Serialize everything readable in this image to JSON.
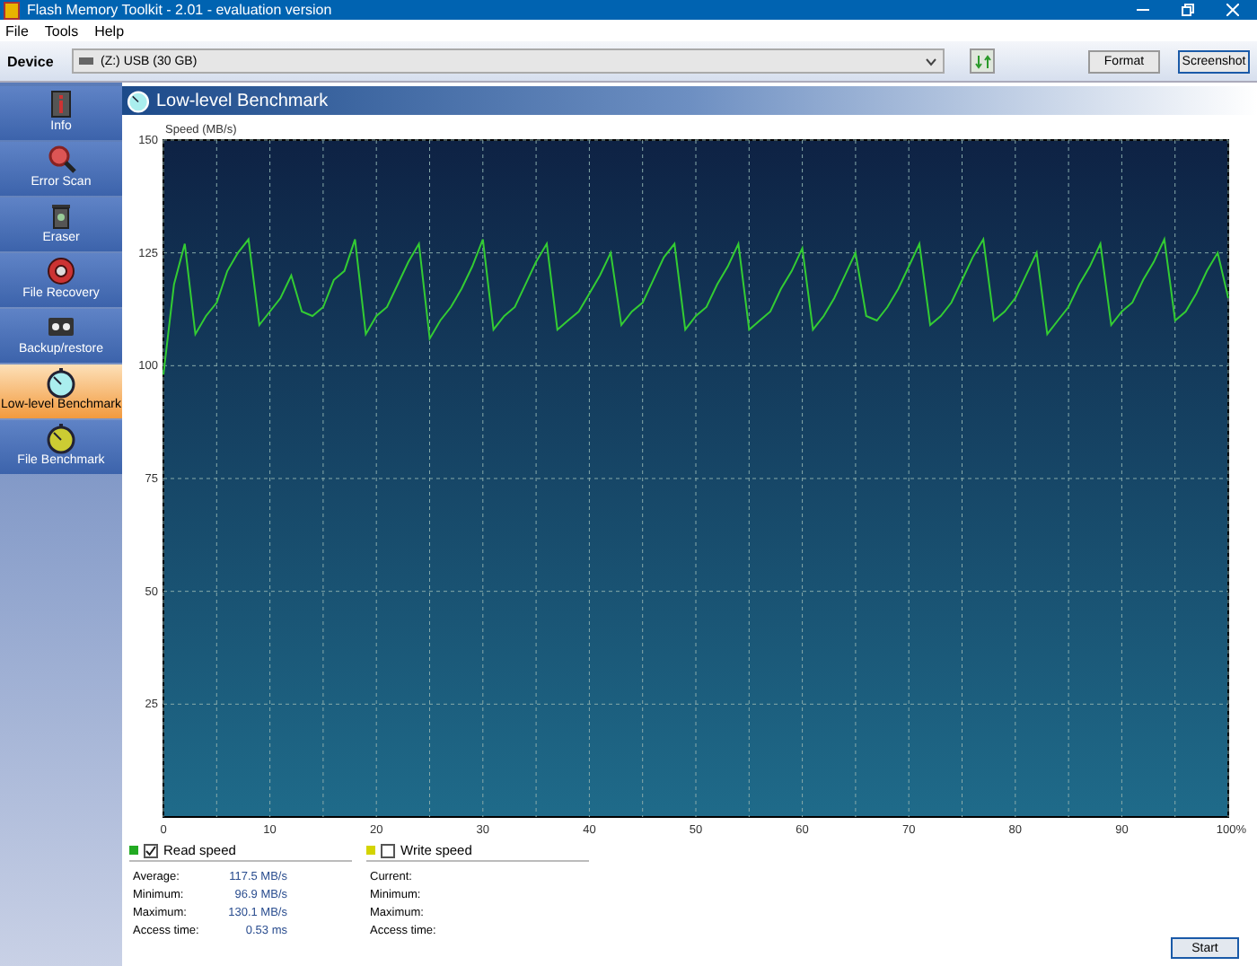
{
  "window": {
    "title": "Flash Memory Toolkit - 2.01 - evaluation version"
  },
  "menu": [
    "File",
    "Tools",
    "Help"
  ],
  "toolbar": {
    "device_label": "Device",
    "device": "(Z:)  USB (30 GB)",
    "buttons": [
      "Format",
      "Screenshot"
    ]
  },
  "sidebar": {
    "items": [
      {
        "label": "Info",
        "selected": false
      },
      {
        "label": "Error Scan",
        "selected": false
      },
      {
        "label": "Eraser",
        "selected": false
      },
      {
        "label": "File Recovery",
        "selected": false
      },
      {
        "label": "Backup/restore",
        "selected": false
      },
      {
        "label": "Low-level Benchmark",
        "selected": true
      },
      {
        "label": "File Benchmark",
        "selected": false
      }
    ]
  },
  "panel": {
    "title": "Low-level Benchmark",
    "chart_data": {
      "type": "line",
      "grid": true,
      "ylabel": "Speed (MB/s)",
      "xlim": [
        0,
        100
      ],
      "ylim": [
        0,
        150
      ],
      "xticks": [
        0,
        10,
        20,
        30,
        40,
        50,
        60,
        70,
        80,
        90,
        {
          "value": 100,
          "label": "100%"
        }
      ],
      "yticks": [
        25,
        50,
        75,
        100,
        125,
        150
      ],
      "x": [
        0,
        1,
        2,
        3,
        4,
        5,
        6,
        7,
        8,
        9,
        10,
        11,
        12,
        13,
        14,
        15,
        16,
        17,
        18,
        19,
        20,
        21,
        22,
        23,
        24,
        25,
        26,
        27,
        28,
        29,
        30,
        31,
        32,
        33,
        34,
        35,
        36,
        37,
        38,
        39,
        40,
        41,
        42,
        43,
        44,
        45,
        46,
        47,
        48,
        49,
        50,
        51,
        52,
        53,
        54,
        55,
        56,
        57,
        58,
        59,
        60,
        61,
        62,
        63,
        64,
        65,
        66,
        67,
        68,
        69,
        70,
        71,
        72,
        73,
        74,
        75,
        76,
        77,
        78,
        79,
        80,
        81,
        82,
        83,
        84,
        85,
        86,
        87,
        88,
        89,
        90,
        91,
        92,
        93,
        94,
        95,
        96,
        97,
        98,
        99,
        100
      ],
      "series": [
        {
          "color": "#33cc33",
          "values": [
            98,
            118,
            127,
            107,
            111,
            114,
            121,
            125,
            128,
            109,
            112,
            115,
            120,
            112,
            111,
            113,
            119,
            121,
            128,
            107,
            111,
            113,
            118,
            123,
            127,
            106,
            110,
            113,
            117,
            122,
            128,
            108,
            111,
            113,
            118,
            123,
            127,
            108,
            110,
            112,
            116,
            120,
            125,
            109,
            112,
            114,
            119,
            124,
            127,
            108,
            111,
            113,
            118,
            122,
            127,
            108,
            110,
            112,
            117,
            121,
            126,
            108,
            111,
            115,
            120,
            125,
            111,
            110,
            113,
            117,
            122,
            127,
            109,
            111,
            114,
            119,
            124,
            128,
            110,
            112,
            115,
            120,
            125,
            107,
            110,
            113,
            118,
            122,
            127,
            109,
            112,
            114,
            119,
            123,
            128,
            110,
            112,
            116,
            121,
            125,
            115
          ]
        }
      ]
    }
  },
  "legends": [
    {
      "label": "Read speed",
      "checked": true,
      "color": "#22aa22",
      "stats": [
        {
          "label": "Average:",
          "value": "117.5 MB/s"
        },
        {
          "label": "Minimum:",
          "value": "96.9 MB/s"
        },
        {
          "label": "Maximum:",
          "value": "130.1 MB/s"
        },
        {
          "label": "Access time:",
          "value": "0.53 ms"
        }
      ]
    },
    {
      "label": "Write speed",
      "checked": false,
      "color": "#d4d400",
      "stats": [
        {
          "label": "Current:"
        },
        {
          "label": "Minimum:"
        },
        {
          "label": "Maximum:"
        },
        {
          "label": "Access time:"
        }
      ]
    }
  ],
  "start_button": "Start"
}
